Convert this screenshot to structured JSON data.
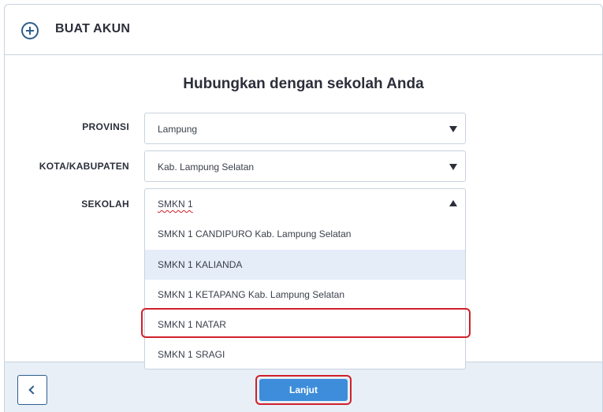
{
  "header": {
    "title": "BUAT AKUN",
    "icon": "plus-circle-icon"
  },
  "form": {
    "heading": "Hubungkan dengan sekolah Anda",
    "province": {
      "label": "PROVINSI",
      "value": "Lampung"
    },
    "city": {
      "label": "KOTA/KABUPATEN",
      "value": "Kab. Lampung Selatan"
    },
    "school": {
      "label": "SEKOLAH",
      "search_value": "SMKN 1",
      "options": [
        "SMKN 1 CANDIPURO Kab. Lampung Selatan",
        "SMKN 1 KALIANDA",
        "SMKN 1 KETAPANG Kab. Lampung Selatan",
        "SMKN 1 NATAR",
        "SMKN 1 SRAGI"
      ],
      "hovered_option": "SMKN 1 KALIANDA",
      "marked_option": "SMKN 1 NATAR"
    }
  },
  "footer": {
    "back_icon": "chevron-left-icon",
    "next_label": "Lanjut"
  },
  "colors": {
    "accent": "#3d8ddb",
    "annotation": "#d0202a",
    "header_icon": "#2d5e8c",
    "footer_bg": "#e8eff7"
  }
}
